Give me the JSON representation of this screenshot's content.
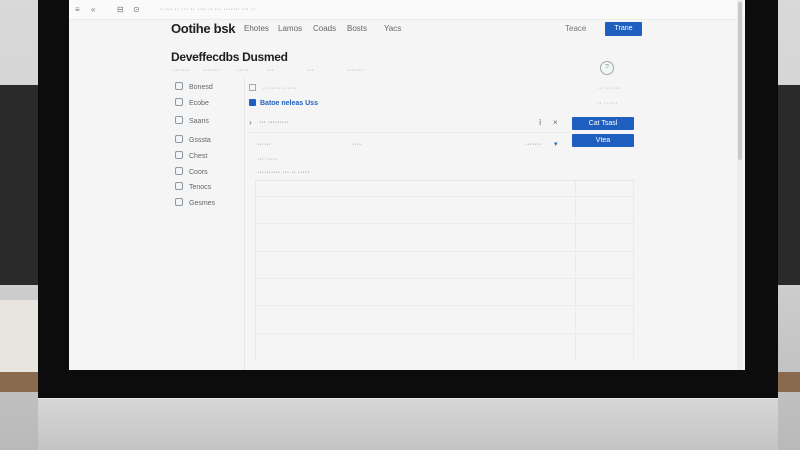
{
  "browser": {
    "nav_icons": [
      "≡",
      "«",
      "⊟",
      "⊙"
    ],
    "address": "·· ··· ·· ··· ·· ···· ·· ··· ······· ··· ··"
  },
  "header": {
    "brand": "Ootihe bsk",
    "nav": [
      "Ehotes",
      "Lamos",
      "Coads",
      "Bosts",
      "Yacs"
    ],
    "sign_in": "Teace",
    "cta": "Trane"
  },
  "page": {
    "title": "Deveffecdbs Dusmed",
    "subtabs": [
      "·······",
      "·······",
      "·····",
      "···",
      "···",
      "·······"
    ],
    "help": "?"
  },
  "sidebar": {
    "items": [
      {
        "label": "Bonesd"
      },
      {
        "label": "Ecobe"
      },
      {
        "label": "Saans"
      },
      {
        "label": "Gsssta"
      },
      {
        "label": "Chest"
      },
      {
        "label": "Coors"
      },
      {
        "label": "Tenocs"
      },
      {
        "label": "Gesmes"
      }
    ]
  },
  "main": {
    "path": "········ ······",
    "path_right": "··· ······",
    "active_link": "Batoe neleas Uss",
    "active_sub": "·· ······",
    "toolbar_label": "··· ·········",
    "toolbar_mid": "ⅰ",
    "toolbar_close": "×",
    "primary_button": "Cat Tsasl",
    "secondary_button": "Vtea",
    "filters": [
      "······",
      "····",
      "·······"
    ],
    "list_header": "··· ·····",
    "list_row_label": "·········· ··· ·· ·····"
  }
}
